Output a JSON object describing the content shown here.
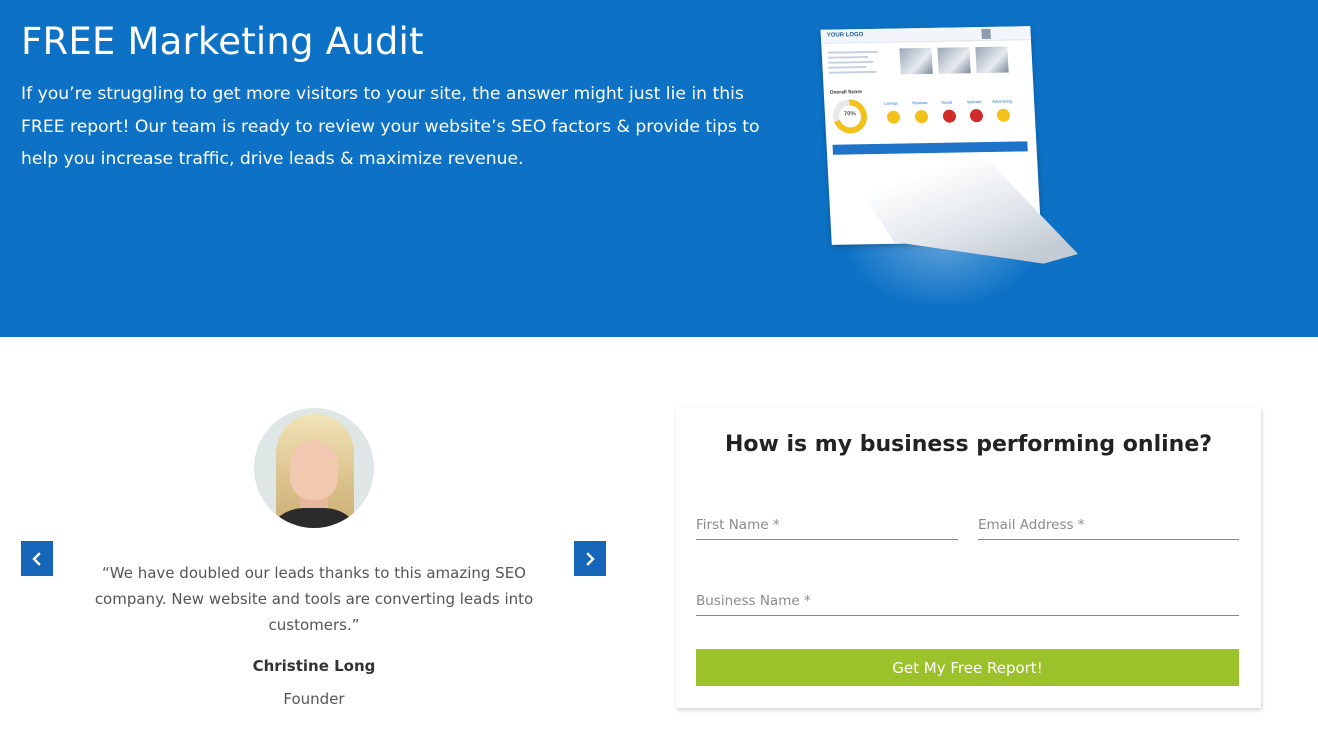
{
  "hero": {
    "title": "FREE Marketing Audit",
    "text": "If you’re struggling to get more visitors to your site, the answer might just lie in this FREE report! Our team is ready to review your website’s SEO factors & provide tips to help you increase traffic, drive leads & maximize revenue.",
    "background_color": "#0d72c6"
  },
  "report_preview": {
    "logo_text": "YOUR LOGO",
    "overall_score_label": "Overall Score",
    "score": "70%",
    "categories": [
      "Listings",
      "Reviews",
      "Social",
      "Website",
      "Advertising"
    ],
    "bar_label": "Listings"
  },
  "testimonial": {
    "quote": "“We have doubled our leads thanks to this amazing SEO company. New website and tools are converting leads into customers.”",
    "author": "Christine Long",
    "role": "Founder",
    "prev_icon": "chevron-left-icon",
    "next_icon": "chevron-right-icon",
    "nav_color": "#1565b8"
  },
  "form": {
    "title": "How is my business performing online?",
    "first_name_placeholder": "First Name *",
    "email_placeholder": "Email Address *",
    "business_placeholder": "Business Name *",
    "submit_label": "Get My Free Report!",
    "submit_color": "#9bc22a"
  }
}
